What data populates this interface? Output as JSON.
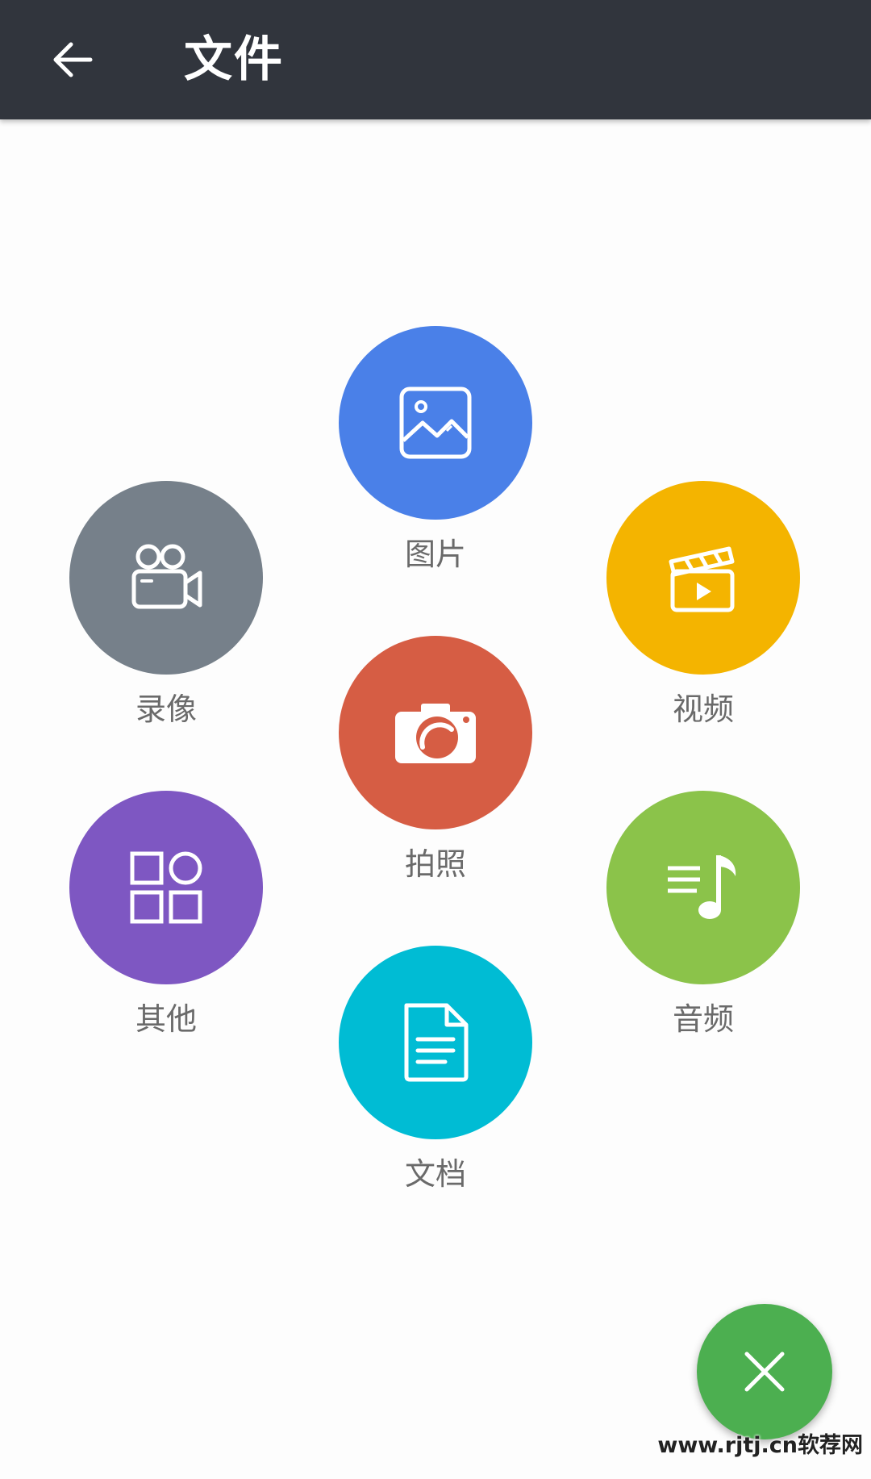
{
  "header": {
    "title": "文件",
    "back_icon": "arrow-left-icon",
    "background": "#31353d"
  },
  "items": [
    {
      "id": "images",
      "label": "图片",
      "color": "#4a80e8",
      "icon": "image-icon"
    },
    {
      "id": "record",
      "label": "录像",
      "color": "#76808a",
      "icon": "video-camera-icon"
    },
    {
      "id": "video",
      "label": "视频",
      "color": "#f4b400",
      "icon": "clapperboard-icon"
    },
    {
      "id": "photo",
      "label": "拍照",
      "color": "#d65d44",
      "icon": "camera-icon"
    },
    {
      "id": "other",
      "label": "其他",
      "color": "#7e57c2",
      "icon": "grid-icon"
    },
    {
      "id": "audio",
      "label": "音频",
      "color": "#8bc34a",
      "icon": "music-note-icon"
    },
    {
      "id": "docs",
      "label": "文档",
      "color": "#00bcd4",
      "icon": "document-icon"
    }
  ],
  "fab": {
    "icon": "close-icon",
    "color": "#4caf50"
  },
  "watermark": {
    "text": "www.rjtj.cn软荐网"
  }
}
